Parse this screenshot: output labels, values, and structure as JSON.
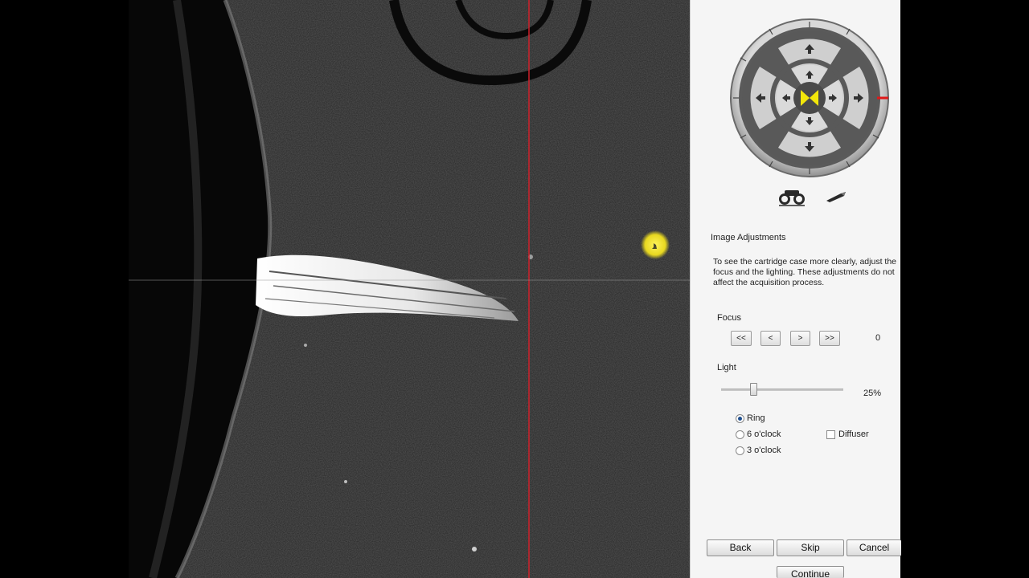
{
  "viewer": {
    "crosshair_color": "#d0202a"
  },
  "panel": {
    "image_adjustments": {
      "heading": "Image Adjustments",
      "description": "To see the cartridge case more clearly, adjust the focus and the lighting. These adjustments do not affect the acquisition process."
    },
    "focus": {
      "label": "Focus",
      "buttons": [
        "<<",
        "<",
        ">",
        ">>"
      ],
      "value": "0"
    },
    "light": {
      "label": "Light",
      "value_text": "25%",
      "level": 0.25,
      "options": [
        {
          "label": "Ring",
          "selected": true
        },
        {
          "label": "6 o'clock",
          "selected": false
        },
        {
          "label": "3 o'clock",
          "selected": false
        }
      ],
      "diffuser": {
        "label": "Diffuser",
        "checked": false
      }
    },
    "navigation": {
      "back": "Back",
      "skip": "Skip",
      "cancel": "Cancel",
      "continue": "Continue"
    },
    "icons": {
      "binoculars": "binoculars-icon",
      "probe": "probe-icon"
    },
    "accent_yellow": "#f2e60a"
  }
}
